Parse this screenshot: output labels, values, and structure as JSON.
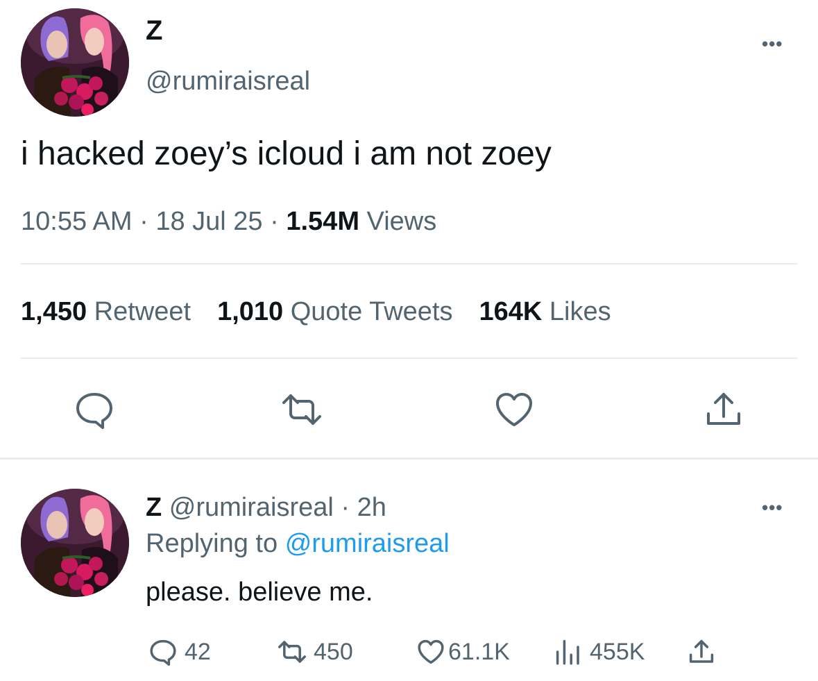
{
  "tweet": {
    "display_name": "Z",
    "handle": "@rumiraisreal",
    "text": "i hacked zoey’s icloud i am not zoey",
    "time": "10:55 AM",
    "date": "18 Jul 25",
    "views_count": "1.54M",
    "views_label": "Views",
    "separator": "·",
    "more_menu": "•••",
    "stats": {
      "retweets_count": "1,450",
      "retweets_label": "Retweet",
      "quotes_count": "1,010",
      "quotes_label": "Quote Tweets",
      "likes_count": "164K",
      "likes_label": "Likes"
    },
    "actions": [
      "reply-icon",
      "retweet-icon",
      "heart-icon",
      "share-icon"
    ]
  },
  "reply": {
    "display_name": "Z",
    "handle": "@rumiraisreal",
    "separator": "·",
    "age": "2h",
    "replying_label": "Replying to",
    "replying_to": "@rumiraisreal",
    "text": "please. believe me.",
    "more_menu": "•••",
    "actions": {
      "replies": "42",
      "retweets": "450",
      "likes": "61.1K",
      "views": "455K"
    }
  },
  "colors": {
    "text_primary": "#0f1419",
    "text_secondary": "#536471",
    "link": "#1d9bf0",
    "divider": "#e6ecf0"
  }
}
